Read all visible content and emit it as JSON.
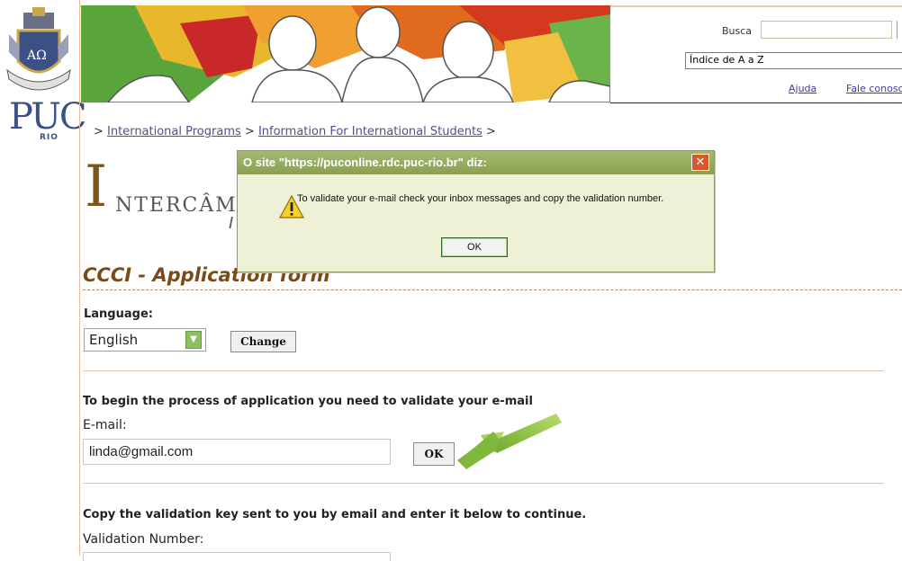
{
  "header": {
    "search_label": "Busca",
    "search_value": "",
    "index_select": "Índice de A a Z",
    "help_link": "Ajuda",
    "contact_link": "Fale conosco"
  },
  "logo": {
    "puc": "PUC",
    "rio": "RIO"
  },
  "breadcrumb": {
    "prefix": "> ",
    "item1": "International Programs",
    "sep1": " > ",
    "item2": "Information For International Students",
    "sep2": " >"
  },
  "brand": {
    "initial": "I",
    "rest": "NTERCÂMBIO",
    "sub": "I"
  },
  "form": {
    "title": "CCCI - Application form",
    "language_label": "Language:",
    "language_value": "English",
    "change_button": "Change",
    "validate_heading": "To begin the process of application you need to validate your e-mail",
    "email_label": "E-mail:",
    "email_value": "linda@gmail.com",
    "ok_button": "OK",
    "validation_heading": "Copy the validation key sent to you by email and enter it below to continue.",
    "validation_label": "Validation Number:"
  },
  "dialog": {
    "title": "O site \"https://puconline.rdc.puc-rio.br\" diz:",
    "message": "To validate your e-mail check your inbox messages and copy the validation number.",
    "ok_button": "OK",
    "close_icon": "close-icon",
    "icon": "warning-icon"
  },
  "colors": {
    "accent_brown": "#7b4a19",
    "dialog_green": "#8aa150",
    "arrow_green": "#8bbf3f",
    "link_purple": "#5a4a8c"
  }
}
